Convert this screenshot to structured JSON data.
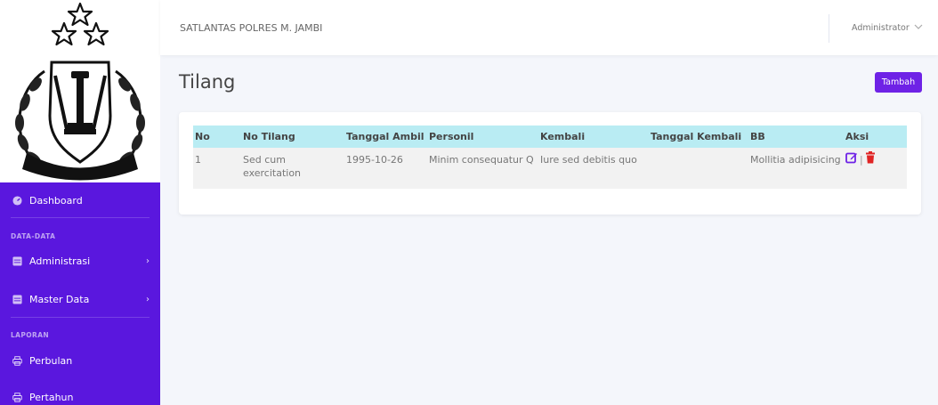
{
  "sidebar": {
    "menu": {
      "dashboard": "Dashboard",
      "heading_data": "DATA-DATA",
      "administrasi": "Administrasi",
      "master_data": "Master Data",
      "heading_laporan": "LAPORAN",
      "perbulan": "Perbulan",
      "pertahun": "Pertahun"
    }
  },
  "topbar": {
    "brand": "SATLANTAS POLRES M. JAMBI",
    "user": "Administrator"
  },
  "page": {
    "title": "Tilang",
    "add_button": "Tambah"
  },
  "table": {
    "headers": [
      "No",
      "No Tilang",
      "Tanggal Ambil",
      "Personil",
      "Kembali",
      "Tanggal Kembali",
      "BB",
      "Aksi"
    ],
    "rows": [
      {
        "no": "1",
        "no_tilang": "Sed cum exercitation",
        "tanggal_ambil": "1995-10-26",
        "personil": "Minim consequatur Q",
        "kembali": "Iure sed debitis quo",
        "tanggal_kembali": "",
        "bb": "Mollitia adipisicing",
        "actions": [
          "edit-icon",
          "trash-icon"
        ]
      }
    ]
  },
  "colors": {
    "sidebar_bg": "#5a17de",
    "button_bg": "#6e22e6",
    "table_header_bg": "#b9ecf3",
    "edit_icon": "#6e22e6",
    "delete_icon": "#e02424"
  }
}
